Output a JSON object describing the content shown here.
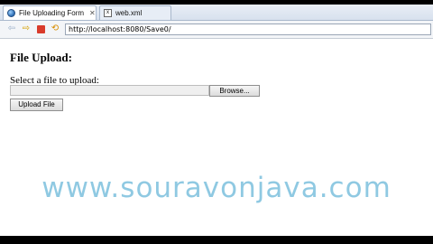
{
  "tabs": [
    {
      "label": "File Uploading Form",
      "icon": "globe-icon",
      "close": "✕"
    },
    {
      "label": "web.xml",
      "icon": "xml-file-icon"
    }
  ],
  "toolbar": {
    "url": "http://localhost:8080/Save0/",
    "icons": [
      "back-icon",
      "forward-icon",
      "stop-icon",
      "refresh-icon"
    ]
  },
  "page": {
    "heading": "File Upload:",
    "select_label": "Select a file to upload:",
    "file_value": "",
    "browse_label": "Browse...",
    "upload_label": "Upload File"
  },
  "watermark": "www.souravonjava.com",
  "colors": {
    "watermark": "#8fc9e2",
    "stop": "#d93b2b"
  }
}
